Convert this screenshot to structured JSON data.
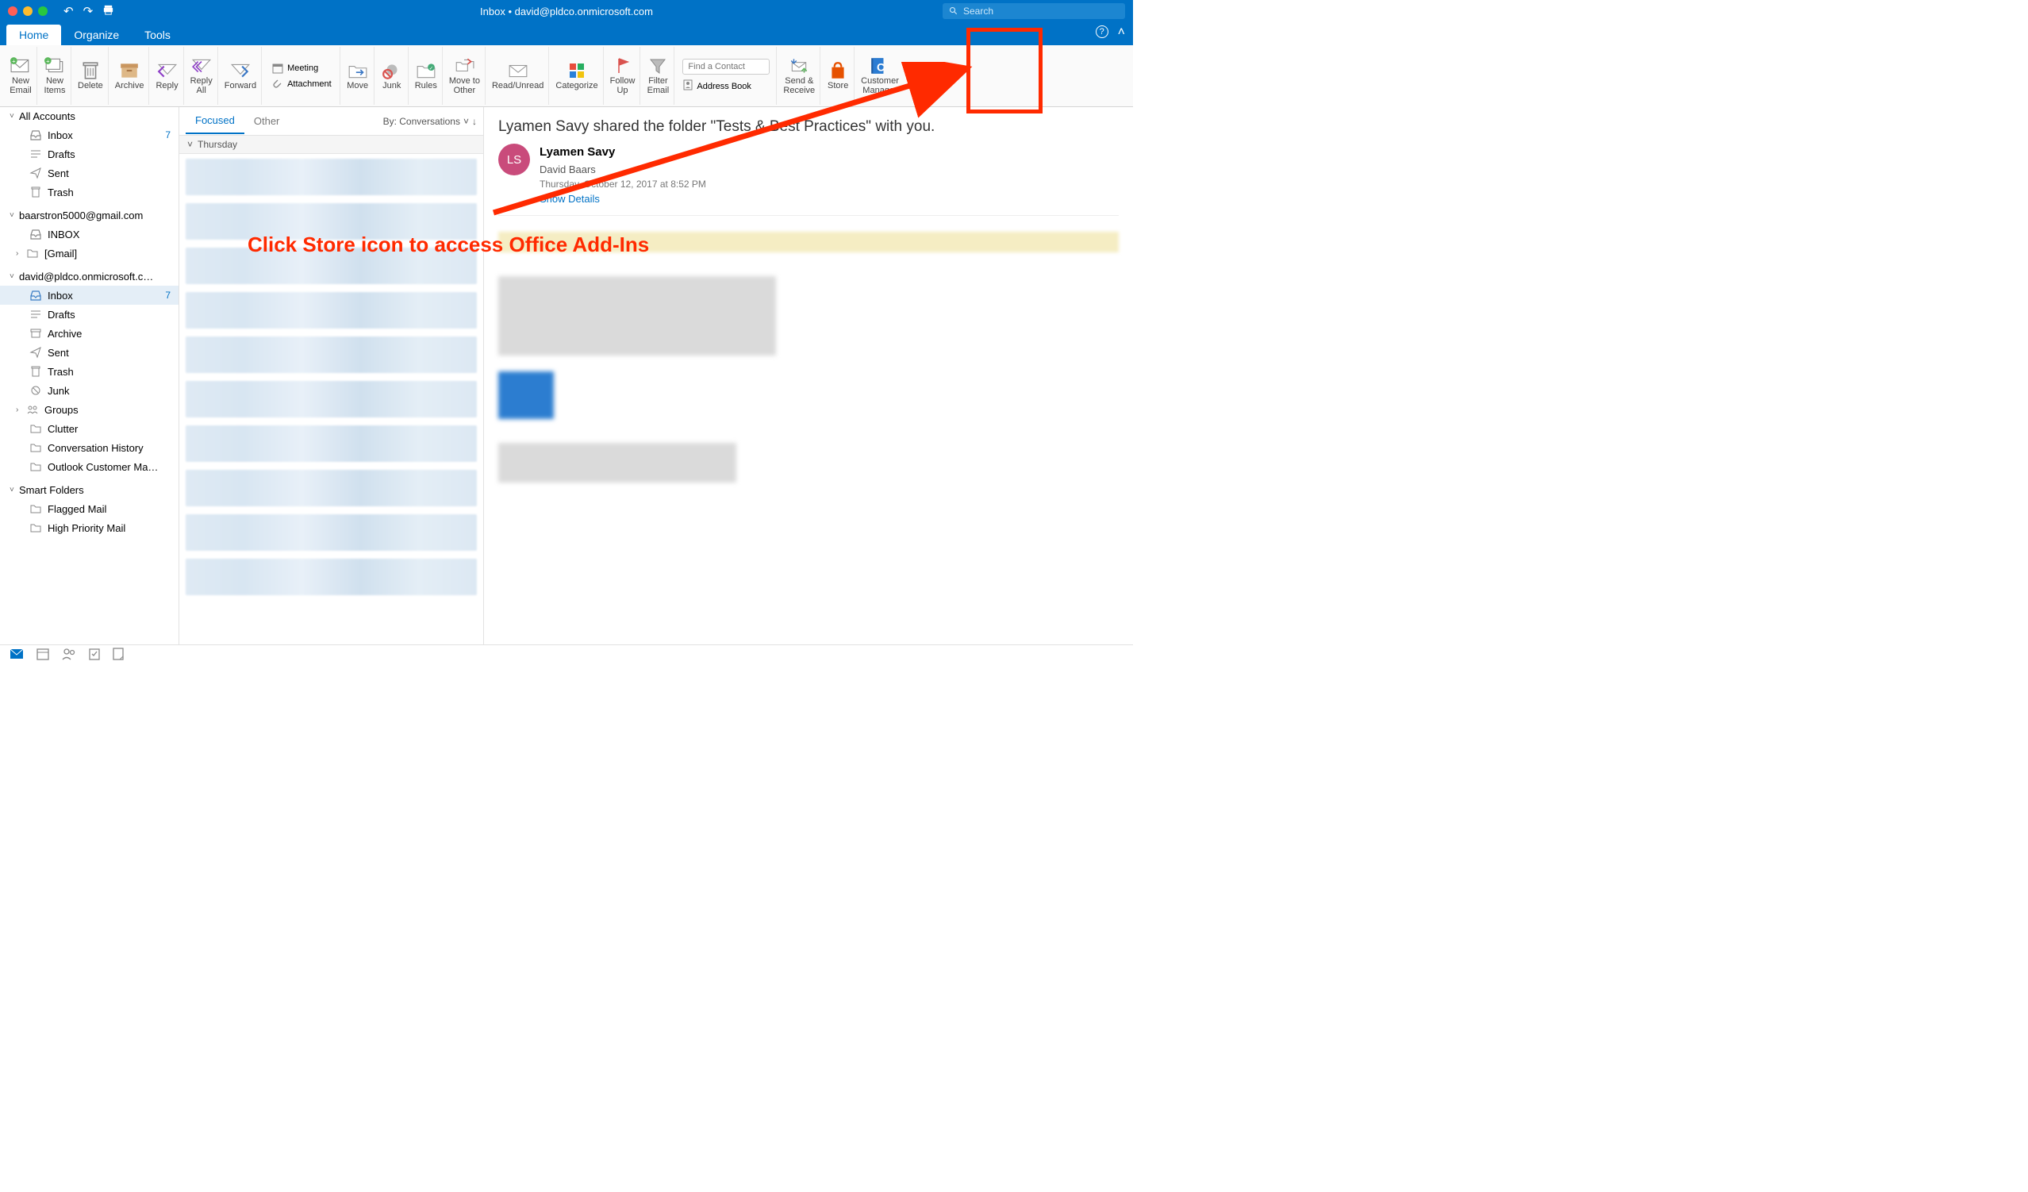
{
  "title": "Inbox • david@pldco.onmicrosoft.com",
  "search": {
    "placeholder": "Search"
  },
  "tabs": {
    "home": "Home",
    "organize": "Organize",
    "tools": "Tools"
  },
  "ribbon": {
    "new_email": "New\nEmail",
    "new_items": "New\nItems",
    "delete": "Delete",
    "archive": "Archive",
    "reply": "Reply",
    "reply_all": "Reply\nAll",
    "forward": "Forward",
    "meeting": "Meeting",
    "attachment": "Attachment",
    "move": "Move",
    "junk": "Junk",
    "rules": "Rules",
    "move_to_other": "Move to\nOther",
    "read_unread": "Read/Unread",
    "categorize": "Categorize",
    "follow_up": "Follow\nUp",
    "filter_email": "Filter\nEmail",
    "find_contact_ph": "Find a Contact",
    "address_book": "Address Book",
    "send_receive": "Send &\nReceive",
    "store": "Store",
    "customer_manager": "Customer\nManager"
  },
  "sidebar": {
    "all_accounts": "All Accounts",
    "inbox": "Inbox",
    "inbox_count": "7",
    "drafts": "Drafts",
    "sent": "Sent",
    "trash": "Trash",
    "account2": "baarstron5000@gmail.com",
    "a2_inbox": "INBOX",
    "a2_gmail": "[Gmail]",
    "account3": "david@pldco.onmicrosoft.c…",
    "a3_inbox": "Inbox",
    "a3_inbox_count": "7",
    "a3_drafts": "Drafts",
    "a3_archive": "Archive",
    "a3_sent": "Sent",
    "a3_trash": "Trash",
    "a3_junk": "Junk",
    "a3_groups": "Groups",
    "a3_clutter": "Clutter",
    "a3_convhist": "Conversation History",
    "a3_ocm": "Outlook Customer Ma…",
    "smart_folders": "Smart Folders",
    "flagged": "Flagged Mail",
    "highpri": "High Priority Mail"
  },
  "msglist": {
    "focused": "Focused",
    "other": "Other",
    "sortby": "By: Conversations",
    "daterow": "Thursday"
  },
  "reading": {
    "subject": "Lyamen Savy shared the folder \"Tests & Best Practices\" with you.",
    "avatar_initials": "LS",
    "sender_name": "Lyamen Savy",
    "recipient": "David Baars",
    "date": "Thursday, October 12, 2017 at 8:52 PM",
    "show_details": "Show Details"
  },
  "annotation": {
    "text": "Click Store icon to access Office Add-Ins"
  }
}
